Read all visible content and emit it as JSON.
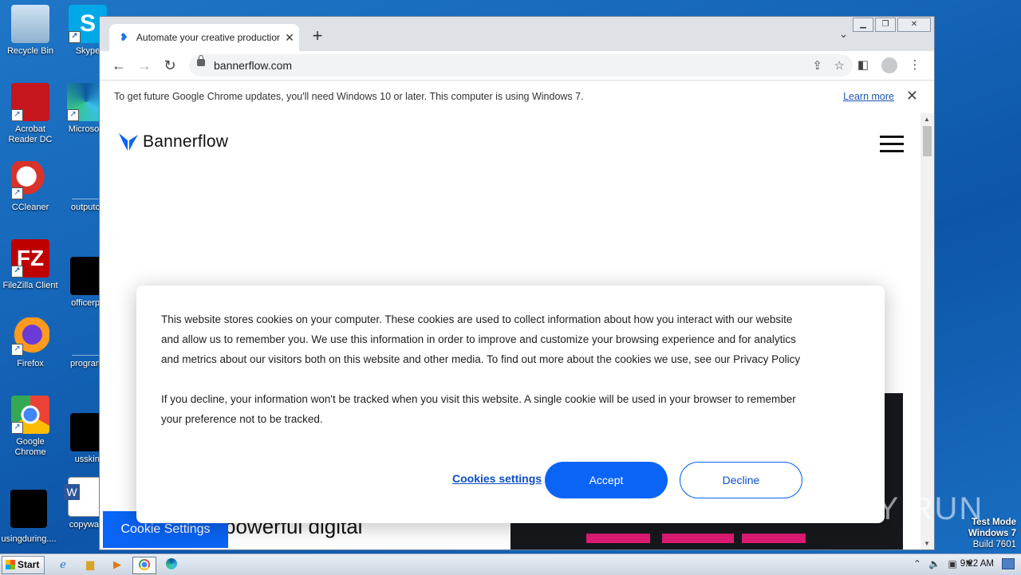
{
  "desktop": {
    "icons_left": [
      {
        "label": "Recycle Bin",
        "icon": "recycle-bin-icon"
      },
      {
        "label": "Acrobat Reader DC",
        "icon": "acrobat-icon"
      },
      {
        "label": "CCleaner",
        "icon": "ccleaner-icon"
      },
      {
        "label": "FileZilla Client",
        "icon": "filezilla-icon"
      },
      {
        "label": "Firefox",
        "icon": "firefox-icon"
      },
      {
        "label": "Google Chrome",
        "icon": "chrome-icon"
      },
      {
        "label": "usingduring....",
        "icon": "file-icon"
      }
    ],
    "icons_right": [
      {
        "label": "Skype",
        "icon": "skype-icon"
      },
      {
        "label": "Microsoft",
        "icon": "edge-icon"
      },
      {
        "label": "outputcd",
        "icon": "file-icon"
      },
      {
        "label": "officerpro",
        "icon": "file-icon"
      },
      {
        "label": "programf",
        "icon": "file-icon"
      },
      {
        "label": "usskin.j",
        "icon": "file-icon"
      },
      {
        "label": "copywant",
        "icon": "word-icon"
      }
    ]
  },
  "browser": {
    "tab_title": "Automate your creative production",
    "new_tab_symbol": "+",
    "url": "bannerflow.com",
    "infobar": {
      "message": "To get future Google Chrome updates, you'll need Windows 10 or later. This computer is using Windows 7.",
      "link": "Learn more"
    }
  },
  "page": {
    "brand": "Bannerflow",
    "headline_line1": "powerful digital",
    "cookie_settings_button": "Cookie Settings",
    "cookie_banner": {
      "paragraph1": "This website stores cookies on your computer. These cookies are used to collect information about how you interact with our website and allow us to remember you. We use this information in order to improve and customize your browsing experience and for analytics and metrics about our visitors both on this website and other media. To find out more about the cookies we use, see our Privacy Policy",
      "paragraph2": "If you decline, your information won't be tracked when you visit this website. A single cookie will be used in your browser to remember your preference not to be tracked.",
      "settings_link": "Cookies settings",
      "accept": "Accept",
      "decline": "Decline"
    }
  },
  "overlay": {
    "watermark": "ANY RUN",
    "test_mode": "Test Mode",
    "os": "Windows 7",
    "build": "Build 7601"
  },
  "taskbar": {
    "start": "Start",
    "clock": "9:22 AM"
  },
  "colors": {
    "accent": "#0a64f5",
    "desktop": "#1565b8"
  }
}
